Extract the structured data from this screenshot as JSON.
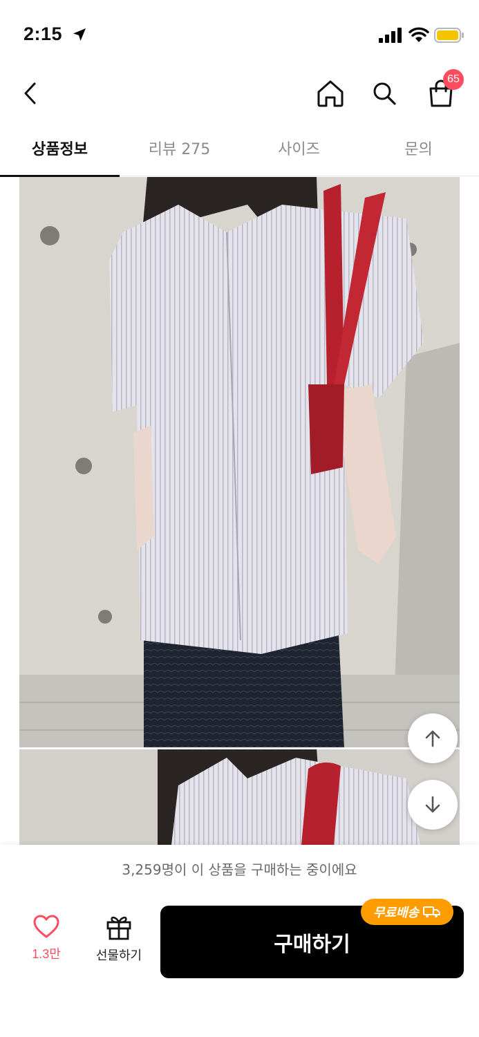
{
  "status_bar": {
    "time": "2:15"
  },
  "nav": {
    "cart_count": "65"
  },
  "tabs": [
    {
      "label": "상품정보",
      "active": true
    },
    {
      "label": "리뷰 275",
      "active": false
    },
    {
      "label": "사이즈",
      "active": false
    },
    {
      "label": "문의",
      "active": false
    }
  ],
  "bottom": {
    "buyer_notice": "3,259명이 이 상품을 구매하는 중이에요",
    "wish_count": "1.3만",
    "gift_label": "선물하기",
    "buy_label": "구매하기",
    "free_shipping": "무료배송"
  },
  "colors": {
    "accent": "#ff4d5f",
    "shipping_badge": "#ff9d00",
    "buy_button": "#000000"
  },
  "icons": [
    "location-arrow-icon",
    "signal-icon",
    "wifi-icon",
    "battery-icon",
    "back-icon",
    "home-icon",
    "search-icon",
    "cart-icon",
    "arrow-up-icon",
    "arrow-down-icon",
    "heart-icon",
    "gift-icon",
    "truck-icon"
  ]
}
